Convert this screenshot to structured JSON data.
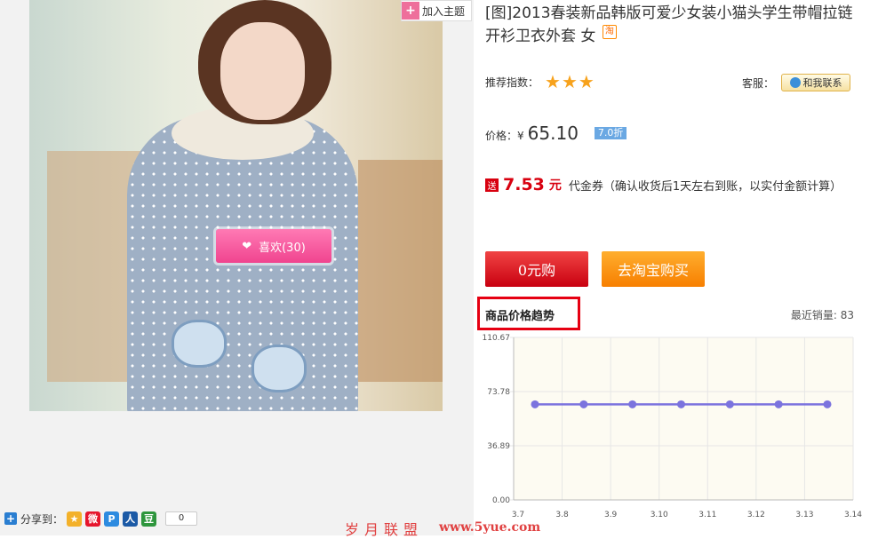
{
  "product": {
    "title": "[图]2013春装新品韩版可爱少女装小猫头学生带帽拉链开衫卫衣外套 女",
    "tao_badge": "淘",
    "add_topic_label": "加入主题",
    "like_label": "喜欢(30)"
  },
  "rating": {
    "label": "推荐指数：",
    "stars": 3,
    "star_glyph": "★"
  },
  "service": {
    "label": "客服：",
    "contact_label": "和我联系"
  },
  "price": {
    "label": "价格：",
    "currency": "¥",
    "value": "65.10",
    "discount": "7.0折"
  },
  "coupon": {
    "badge": "送",
    "amount": "7.53",
    "unit": "元",
    "text": "代金券（确认收货后1天左右到账，以实付金额计算）"
  },
  "buttons": {
    "zero_buy": "0元购",
    "taobao_buy": "去淘宝购买"
  },
  "trend": {
    "title": "商品价格趋势",
    "recent_sales": "最近销量: 83"
  },
  "share": {
    "label": "分享到：",
    "count": "0",
    "icons": [
      {
        "name": "qzone-share-icon",
        "glyph": "★",
        "color": "#f3b12a"
      },
      {
        "name": "weibo-share-icon",
        "glyph": "微",
        "color": "#e6162d"
      },
      {
        "name": "pengyou-share-icon",
        "glyph": "P",
        "color": "#2d8be0"
      },
      {
        "name": "renren-share-icon",
        "glyph": "人",
        "color": "#1c5aa6"
      },
      {
        "name": "douban-share-icon",
        "glyph": "豆",
        "color": "#2e963d"
      }
    ]
  },
  "watermark": {
    "text": "岁月联盟",
    "url": "www.5yue.com"
  },
  "chart_data": {
    "type": "line",
    "x": [
      "3.7",
      "3.8",
      "3.9",
      "3.10",
      "3.11",
      "3.12",
      "3.13",
      "3.14"
    ],
    "values": [
      65.1,
      65.1,
      65.1,
      65.1,
      65.1,
      65.1,
      65.1
    ],
    "y_ticks": [
      "0.00",
      "36.89",
      "73.78",
      "110.67"
    ],
    "ylim": [
      0,
      110.67
    ],
    "grid": true,
    "line_color": "#7b73de",
    "background": "#fdfbf2"
  }
}
